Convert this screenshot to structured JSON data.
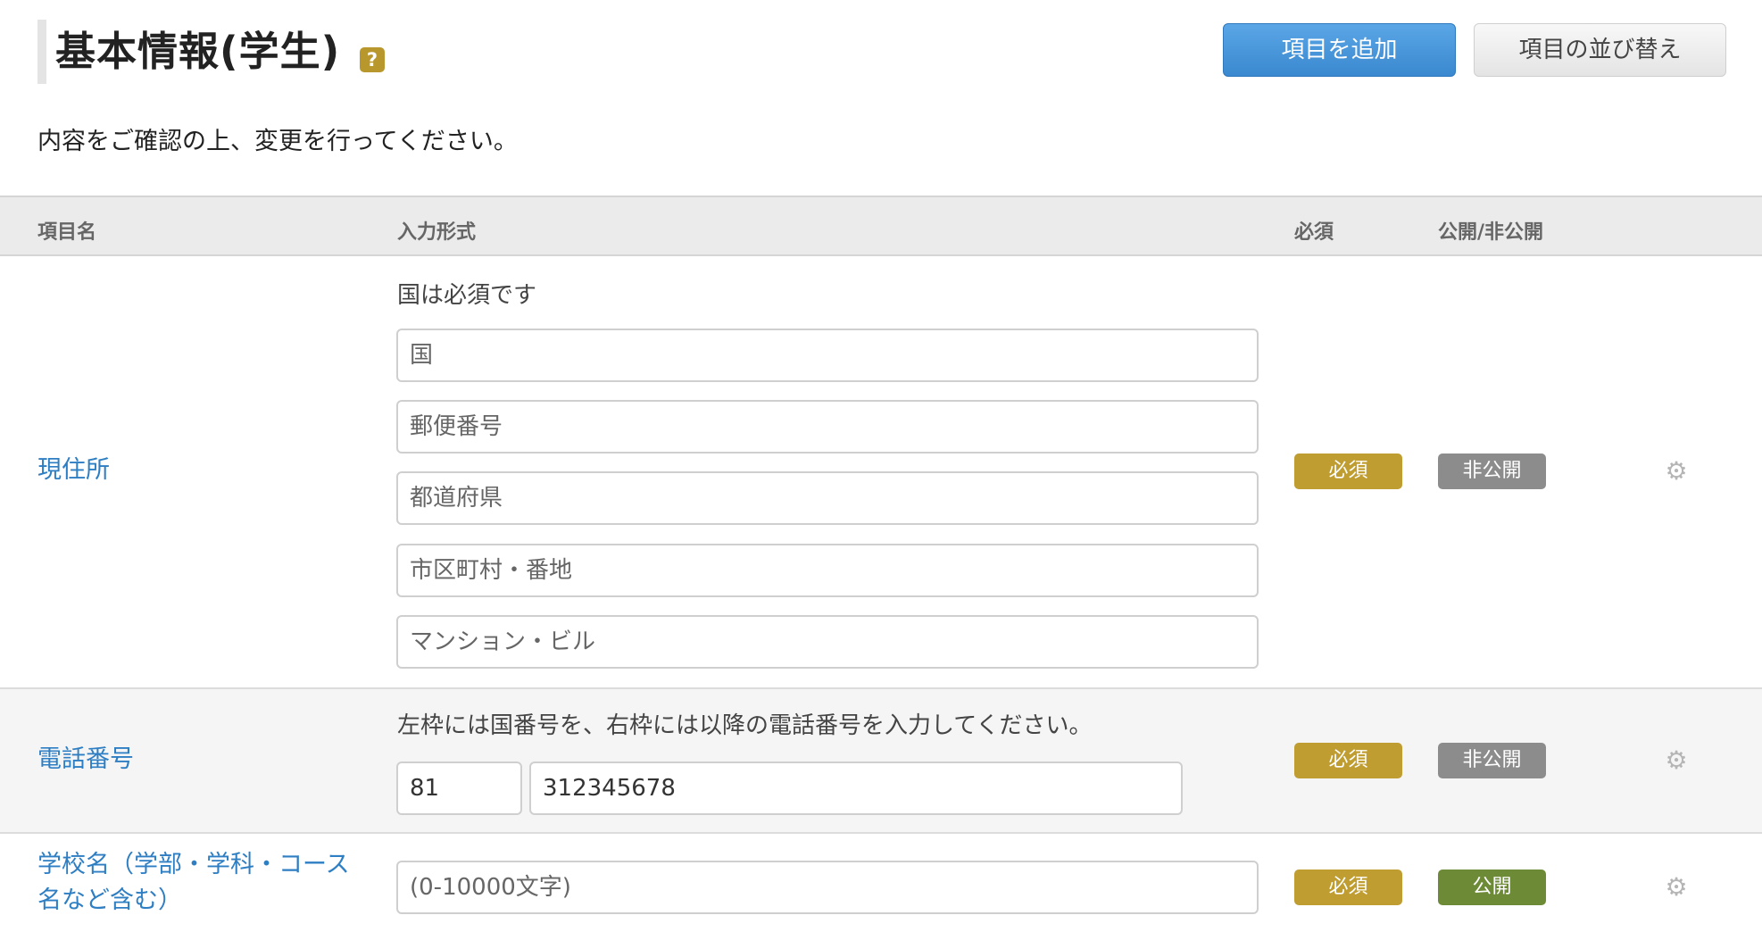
{
  "header": {
    "title": "基本情報(学生)",
    "help_icon": "?",
    "add_button": "項目を追加",
    "sort_button": "項目の並び替え"
  },
  "instruction": "内容をご確認の上、変更を行ってください。",
  "table": {
    "columns": [
      "項目名",
      "入力形式",
      "必須",
      "公開/非公開"
    ],
    "rows": [
      {
        "name": "現住所",
        "hint": "国は必須です",
        "inputs": [
          "国",
          "郵便番号",
          "都道府県",
          "市区町村・番地",
          "マンション・ビル"
        ],
        "required": "必須",
        "visibility": "非公開"
      },
      {
        "name": "電話番号",
        "hint": "左枠には国番号を、右枠には以降の電話番号を入力してください。",
        "country_code": "81",
        "number": "312345678",
        "required": "必須",
        "visibility": "非公開"
      },
      {
        "name": "学校名（学部・学科・コース名など含む）",
        "placeholder": "(0-10000文字)",
        "required": "必須",
        "visibility": "公開"
      }
    ]
  },
  "icons": {
    "settings": "gear-icon",
    "help": "question-icon"
  },
  "colors": {
    "link": "#2e7ec3",
    "primary_button": "#3a88cf",
    "required_badge": "#bf9d30",
    "private_badge": "#8c8c8c",
    "public_badge": "#6d8a36"
  }
}
